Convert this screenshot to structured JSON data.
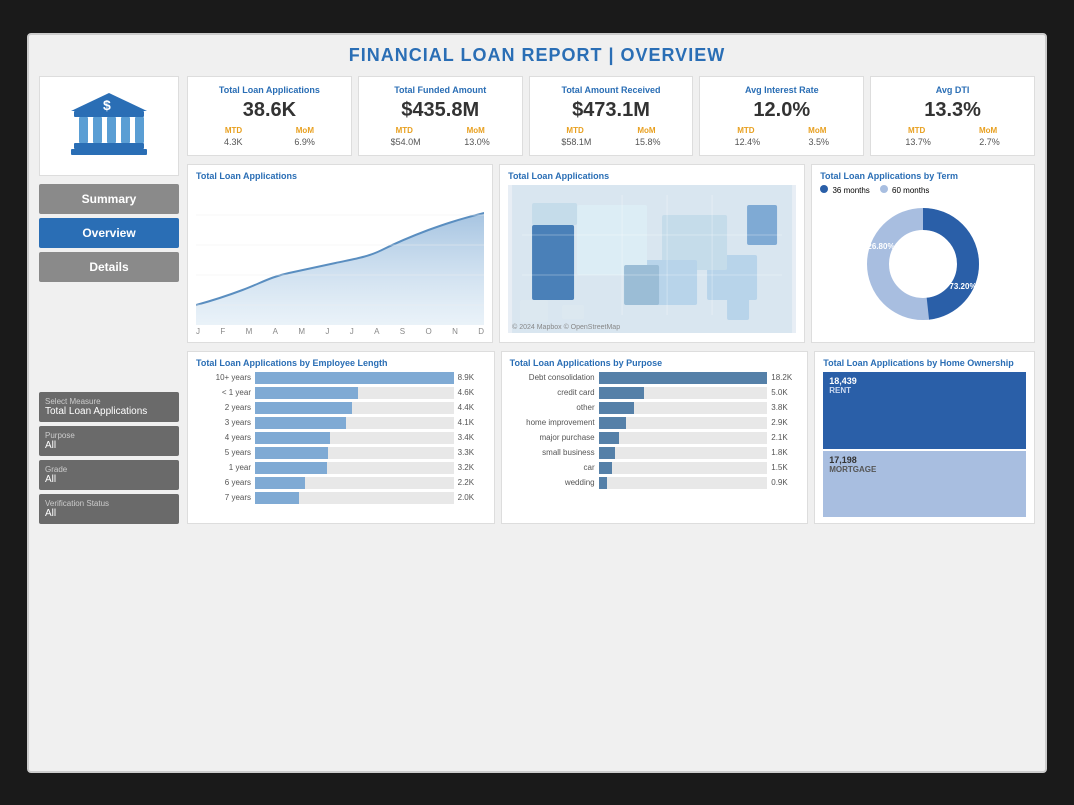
{
  "title": {
    "text": "FINANCIAL LOAN REPORT | ",
    "highlight": "OVERVIEW"
  },
  "nav": {
    "summary_label": "Summary",
    "overview_label": "Overview",
    "details_label": "Details",
    "active": "overview"
  },
  "filters": [
    {
      "label": "Select Measure",
      "value": "Total Loan Applications"
    },
    {
      "label": "Purpose",
      "value": "All"
    },
    {
      "label": "Grade",
      "value": "All"
    },
    {
      "label": "Verification Status",
      "value": "All"
    }
  ],
  "kpis": [
    {
      "title": "Total Loan Applications",
      "value": "38.6K",
      "mtd_label": "MTD",
      "mom_label": "MoM",
      "mtd_value": "4.3K",
      "mom_value": "6.9%"
    },
    {
      "title": "Total Funded Amount",
      "value": "$435.8M",
      "mtd_label": "MTD",
      "mom_label": "MoM",
      "mtd_value": "$54.0M",
      "mom_value": "13.0%"
    },
    {
      "title": "Total Amount Received",
      "value": "$473.1M",
      "mtd_label": "MTD",
      "mom_label": "MoM",
      "mtd_value": "$58.1M",
      "mom_value": "15.8%"
    },
    {
      "title": "Avg Interest Rate",
      "value": "12.0%",
      "mtd_label": "MTD",
      "mom_label": "MoM",
      "mtd_value": "12.4%",
      "mom_value": "3.5%"
    },
    {
      "title": "Avg DTI",
      "value": "13.3%",
      "mtd_label": "MTD",
      "mom_label": "MoM",
      "mtd_value": "13.7%",
      "mom_value": "2.7%"
    }
  ],
  "charts": {
    "line_chart_title": "Total Loan Applications",
    "line_months": [
      "J",
      "F",
      "M",
      "A",
      "M",
      "J",
      "J",
      "A",
      "S",
      "O",
      "N",
      "D"
    ],
    "map_title": "Total Loan Applications",
    "map_credit": "© 2024 Mapbox © OpenStreetMap",
    "donut_title": "Total Loan Applications by Term",
    "donut_legend": [
      {
        "label": "36 months",
        "color": "#2a5fa8"
      },
      {
        "label": "60 months",
        "color": "#a8bee0"
      }
    ],
    "donut_pct_outer": "73.20%",
    "donut_pct_inner": "26.80%"
  },
  "employee_length": {
    "title": "Total Loan Applications by Employee Length",
    "bars": [
      {
        "label": "10+ years",
        "value": "8.9K",
        "pct": 100
      },
      {
        "label": "< 1 year",
        "value": "4.6K",
        "pct": 52
      },
      {
        "label": "2 years",
        "value": "4.4K",
        "pct": 49
      },
      {
        "label": "3 years",
        "value": "4.1K",
        "pct": 46
      },
      {
        "label": "4 years",
        "value": "3.4K",
        "pct": 38
      },
      {
        "label": "5 years",
        "value": "3.3K",
        "pct": 37
      },
      {
        "label": "1 year",
        "value": "3.2K",
        "pct": 36
      },
      {
        "label": "6 years",
        "value": "2.2K",
        "pct": 25
      },
      {
        "label": "7 years",
        "value": "2.0K",
        "pct": 22
      }
    ]
  },
  "purpose": {
    "title": "Total Loan Applications by Purpose",
    "bars": [
      {
        "label": "Debt consolidation",
        "value": "18.2K",
        "pct": 100
      },
      {
        "label": "credit card",
        "value": "5.0K",
        "pct": 27
      },
      {
        "label": "other",
        "value": "3.8K",
        "pct": 21
      },
      {
        "label": "home improvement",
        "value": "2.9K",
        "pct": 16
      },
      {
        "label": "major purchase",
        "value": "2.1K",
        "pct": 12
      },
      {
        "label": "small business",
        "value": "1.8K",
        "pct": 10
      },
      {
        "label": "car",
        "value": "1.5K",
        "pct": 8
      },
      {
        "label": "wedding",
        "value": "0.9K",
        "pct": 5
      }
    ]
  },
  "ownership": {
    "title": "Total Loan Applications by Home Ownership",
    "items": [
      {
        "label": "18,439",
        "sublabel": "RENT",
        "color": "#2a5fa8",
        "flex": 3
      },
      {
        "label": "17,198",
        "sublabel": "MORTGAGE",
        "color": "#a8bee0",
        "flex": 2.5
      }
    ]
  }
}
